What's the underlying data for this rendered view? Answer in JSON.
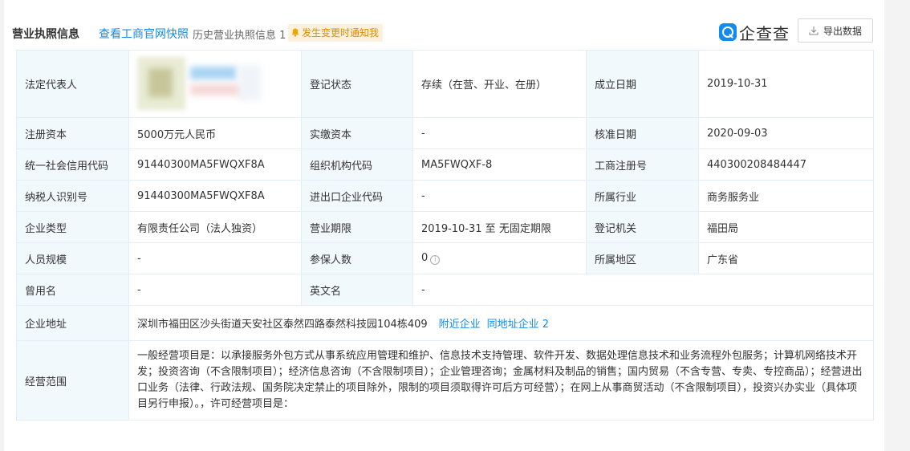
{
  "header": {
    "title": "营业执照信息",
    "official_link": "查看工商官网快照",
    "history_label": "历史营业执照信息",
    "history_count": "1",
    "notify_label": "发生变更时通知我",
    "logo_text": "企查查",
    "export_label": "导出数据"
  },
  "rows": {
    "legal_rep": {
      "label": "法定代表人"
    },
    "reg_status": {
      "label": "登记状态",
      "value": "存续（在营、开业、在册）"
    },
    "est_date": {
      "label": "成立日期",
      "value": "2019-10-31"
    },
    "reg_capital": {
      "label": "注册资本",
      "value": "5000万元人民币"
    },
    "paid_capital": {
      "label": "实缴资本",
      "value": "-"
    },
    "approve_date": {
      "label": "核准日期",
      "value": "2020-09-03"
    },
    "credit_code": {
      "label": "统一社会信用代码",
      "value": "91440300MA5FWQXF8A"
    },
    "org_code": {
      "label": "组织机构代码",
      "value": "MA5FWQXF-8"
    },
    "biz_reg_no": {
      "label": "工商注册号",
      "value": "440300208484447"
    },
    "taxpayer_id": {
      "label": "纳税人识别号",
      "value": "91440300MA5FWQXF8A"
    },
    "import_export": {
      "label": "进出口企业代码",
      "value": "-"
    },
    "industry": {
      "label": "所属行业",
      "value": "商务服务业"
    },
    "company_type": {
      "label": "企业类型",
      "value": "有限责任公司（法人独资）"
    },
    "biz_term": {
      "label": "营业期限",
      "value": "2019-10-31 至 无固定期限"
    },
    "reg_authority": {
      "label": "登记机关",
      "value": "福田局"
    },
    "staff_size": {
      "label": "人员规模",
      "value": "-"
    },
    "insured": {
      "label": "参保人数",
      "value": "0"
    },
    "region": {
      "label": "所属地区",
      "value": "广东省"
    },
    "former_name": {
      "label": "曾用名",
      "value": "-"
    },
    "english_name": {
      "label": "英文名",
      "value": "-"
    },
    "address": {
      "label": "企业地址",
      "value": "深圳市福田区沙头街道天安社区泰然四路泰然科技园104栋409",
      "nearby_link": "附近企业",
      "same_addr_link": "同地址企业 2"
    },
    "scope": {
      "label": "经营范围",
      "value": "一般经营项目是：以承接服务外包方式从事系统应用管理和维护、信息技术支持管理、软件开发、数据处理信息技术和业务流程外包服务；计算机网络技术开发；投资咨询（不含限制项目）；经济信息咨询（不含限制项目）；企业管理咨询；金属材料及制品的销售；国内贸易（不含专营、专卖、专控商品）；经营进出口业务（法律、行政法规、国务院决定禁止的项目除外，限制的项目须取得许可后方可经营）；在网上从事商贸活动（不含限制项目），投资兴办实业（具体项目另行申报）。，许可经营项目是："
    }
  },
  "colors": {
    "accent": "#128bed",
    "label_bg": "#f2f9fc",
    "border": "#e4eef6",
    "notify_bg": "#fdf1dc",
    "notify_text": "#e08a00"
  }
}
